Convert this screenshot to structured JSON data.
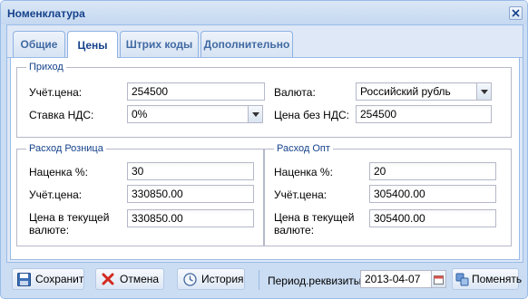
{
  "window": {
    "title": "Номенклатура"
  },
  "tabs": [
    {
      "label": "Общие"
    },
    {
      "label": "Цены"
    },
    {
      "label": "Штрих коды"
    },
    {
      "label": "Дополнительно"
    }
  ],
  "prihod": {
    "legend": "Приход",
    "uchet_label": "Учёт.цена:",
    "uchet_value": "254500",
    "nds_label": "Ставка НДС:",
    "nds_value": "0%",
    "currency_label": "Валюта:",
    "currency_value": "Российский рубль",
    "price_no_vat_label": "Цена без НДС:",
    "price_no_vat_value": "254500"
  },
  "retail": {
    "legend": "Расход Розница",
    "markup_label": "Наценка %:",
    "markup_value": "30",
    "uchet_label": "Учёт.цена:",
    "uchet_value": "330850.00",
    "current_label_1": "Цена в текущей",
    "current_label_2": "валюте:",
    "current_value": "330850.00"
  },
  "wholesale": {
    "legend": "Расход Опт",
    "markup_label": "Наценка %:",
    "markup_value": "20",
    "uchet_label": "Учёт.цена:",
    "uchet_value": "305400.00",
    "current_label_1": "Цена в текущей",
    "current_label_2": "валюте:",
    "current_value": "305400.00"
  },
  "footer": {
    "save_label": "Сохранит",
    "cancel_label": "Отмена",
    "history_label": "История",
    "period_label": "Период.реквизиты:",
    "period_value": "2013-04-07",
    "change_label": "Поменять"
  },
  "colors": {
    "accent": "#15428b",
    "border": "#99bbe8",
    "panel_bg": "#dfe8f6"
  }
}
